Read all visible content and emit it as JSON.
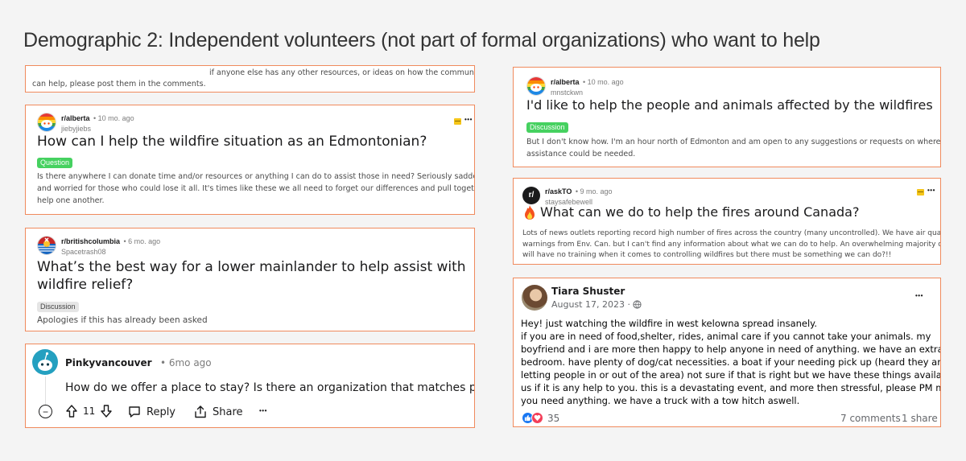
{
  "page": {
    "title": "Demographic 2: Independent volunteers (not part of formal organizations) who want to help"
  },
  "card1": {
    "line1": "if anyone else has any other resources, or ideas on how the community",
    "line2": "can help, please post them in the comments."
  },
  "card2": {
    "subreddit": "r/alberta",
    "age": "• 10 mo. ago",
    "username": "jiebyjiebs",
    "title": "How can I help the wildfire situation as an Edmontonian?",
    "flair": "Question",
    "body_lines": [
      "Is there anywhere I can donate time and/or resources or anything I can do to assist those in need? Seriously saddened",
      "and worried for those who could lose it all. It's times like these we all need to forget our differences and pull together to",
      "help one another."
    ],
    "more": "•••"
  },
  "card3": {
    "subreddit": "r/britishcolumbia",
    "age": "• 6 mo. ago",
    "username": "Spacetrash08",
    "title_lines": [
      "What’s the best way for a lower mainlander to help assist with",
      "wildfire relief?"
    ],
    "flair": "Discussion",
    "body": "Apologies if this has already been asked"
  },
  "card4": {
    "username": "Pinkyvancouver",
    "age": "• 6mo ago",
    "body": "How do we offer a place to stay? Is there an organization that matches people",
    "collapse": "−",
    "votes": "11",
    "reply": "Reply",
    "share": "Share",
    "more": "•••"
  },
  "card5": {
    "subreddit": "r/alberta",
    "age": "• 10 mo. ago",
    "username": "mnstckwn",
    "title": "I'd like to help the people and animals affected by the wildfires",
    "flair": "Discussion",
    "body_lines": [
      "But I don't know how. I'm an hour north of Edmonton and am open to any suggestions or requests on where my",
      "assistance could be needed."
    ]
  },
  "card6": {
    "subreddit": "r/askTO",
    "age": "• 9 mo. ago",
    "username": "staysafebewell",
    "avatar_text": "r/",
    "title": "What can we do to help the fires around Canada?",
    "body_lines": [
      "Lots of news outlets reporting record high number of fires across the country (many uncontrolled). We have air quality",
      "warnings from Env. Can. but I can't find any information about what we can do to help. An overwhelming majority of us",
      "will have no training when it comes to controlling wildfires but there must be something we can do?!!"
    ],
    "more": "•••"
  },
  "card7": {
    "name": "Tiara Shuster",
    "date": "August 17, 2023 ·",
    "more": "•••",
    "body_lines": [
      "Hey! just watching the wildfire in west kelowna spread insanely.",
      "if you are in need of food,shelter, rides, animal care if you cannot take your animals. my",
      "boyfriend and i are more then happy to help anyone in need of anything. we have an extra",
      "bedroom. have plenty of dog/cat necessities. a boat if your needing pick up (heard they aren't",
      "letting people in or out of the area) not sure if that is right but we have these things available to",
      "us if it is any help to you. this is a devastating event, and more then stressful, please PM me if",
      "you need anything. we have a truck with a tow hitch aswell."
    ],
    "reactions": "35",
    "comments": "7 comments",
    "shares": "1 share"
  },
  "colors": {
    "card_border": "#f08a5d",
    "question_flair": "#46d160",
    "discussion_flair": "#e5e5e5",
    "facebook_like": "#1877f2",
    "facebook_love": "#f33e58"
  },
  "icons": {
    "reddit_avatar": "snoo-icon",
    "fire": "fire-icon",
    "globe": "globe-icon",
    "upvote": "arrow-up-icon",
    "downvote": "arrow-down-icon",
    "reply": "comment-icon",
    "share": "share-icon"
  }
}
